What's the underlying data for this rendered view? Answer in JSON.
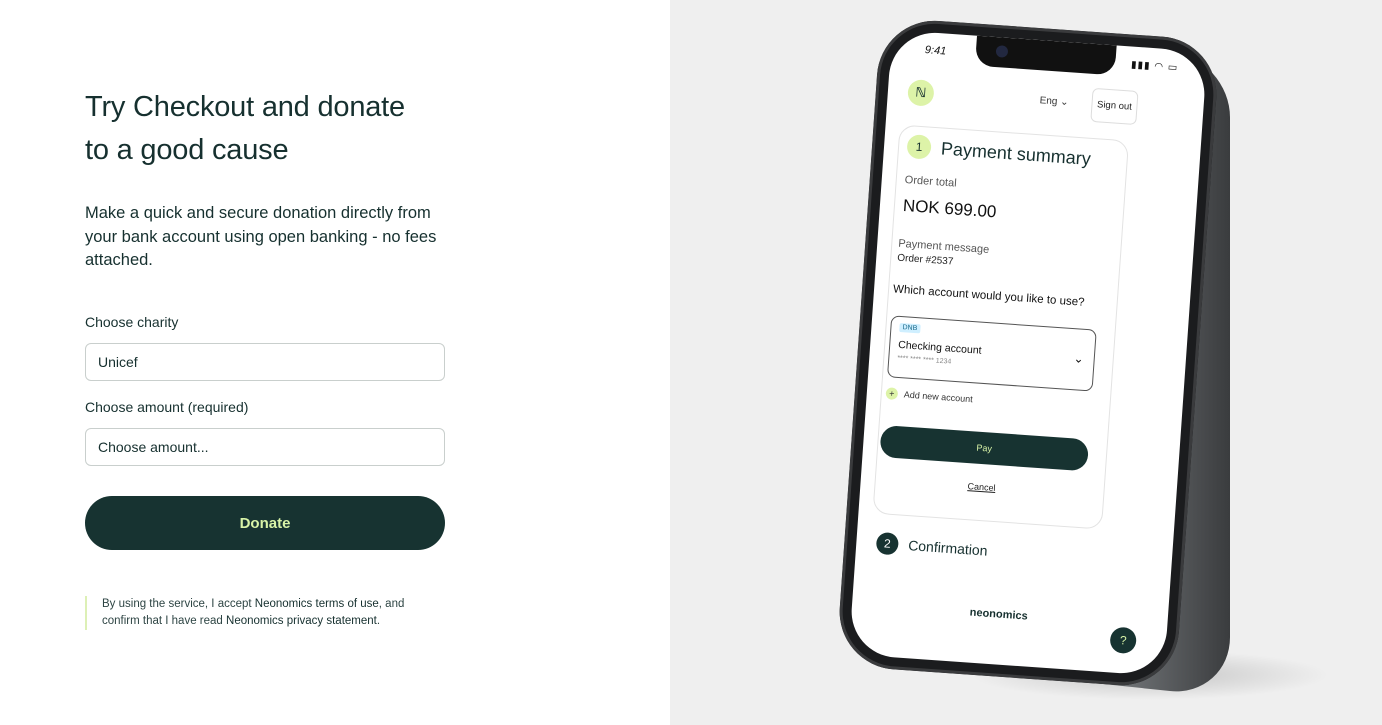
{
  "form": {
    "title_line1": "Try Checkout and donate",
    "title_line2": "to a good cause",
    "subtitle": "Make a quick and secure donation directly from your bank account using open banking - no fees attached.",
    "charity_label": "Choose charity",
    "charity_value": "Unicef",
    "amount_label": "Choose amount (required)",
    "amount_placeholder": "Choose amount...",
    "donate_label": "Donate",
    "terms": {
      "part1": "By using the service, I accept ",
      "link1": "Neonomics terms of use",
      "part2": ", and confirm that I have read ",
      "link2": "Neonomics privacy statement",
      "part3": "."
    }
  },
  "phone": {
    "time": "9:41",
    "status_icons": "signal-wifi-battery",
    "logo_icon": "neonomics-logo-icon",
    "lang": "Eng",
    "signout": "Sign out",
    "step1_number": "1",
    "step1_title": "Payment summary",
    "order_total_label": "Order total",
    "order_total_value": "NOK 699.00",
    "payment_message_label": "Payment message",
    "payment_message_value": "Order #2537",
    "account_question": "Which account would you like to use?",
    "bank_badge": "DNB",
    "account_name": "Checking account",
    "account_number": "**** **** **** 1234",
    "add_account": "Add new account",
    "pay": "Pay",
    "cancel": "Cancel",
    "step2_number": "2",
    "step2_title": "Confirmation",
    "brand": "neonomics",
    "help_icon": "question-icon"
  },
  "colors": {
    "primary": "#173331",
    "accent": "#d8f3a7",
    "right_bg": "#efefef"
  }
}
